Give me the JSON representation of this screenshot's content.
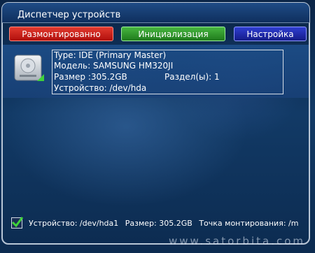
{
  "window": {
    "title": "Диспетчер устройств"
  },
  "buttons": {
    "unmount": "Размонтированно",
    "initialize": "Инициализация",
    "settings": "Настройка"
  },
  "device": {
    "type": "Type: IDE (Primary Master)",
    "model": "Модель: SAMSUNG HM320JI",
    "size": "Размер :305.2GB",
    "partitions": "Раздел(ы): 1",
    "path": "Устройство: /dev/hda"
  },
  "status": {
    "device": "Устройство: /dev/hda1",
    "size": "Размер: 305.2GB",
    "mount": "Точка монтирования: /m"
  },
  "watermark": "www.satorbita.com",
  "colors": {
    "red_button": "#c8201a",
    "green_button": "#36a030",
    "blue_button": "#2330b8",
    "check_green": "#3fd23a"
  }
}
